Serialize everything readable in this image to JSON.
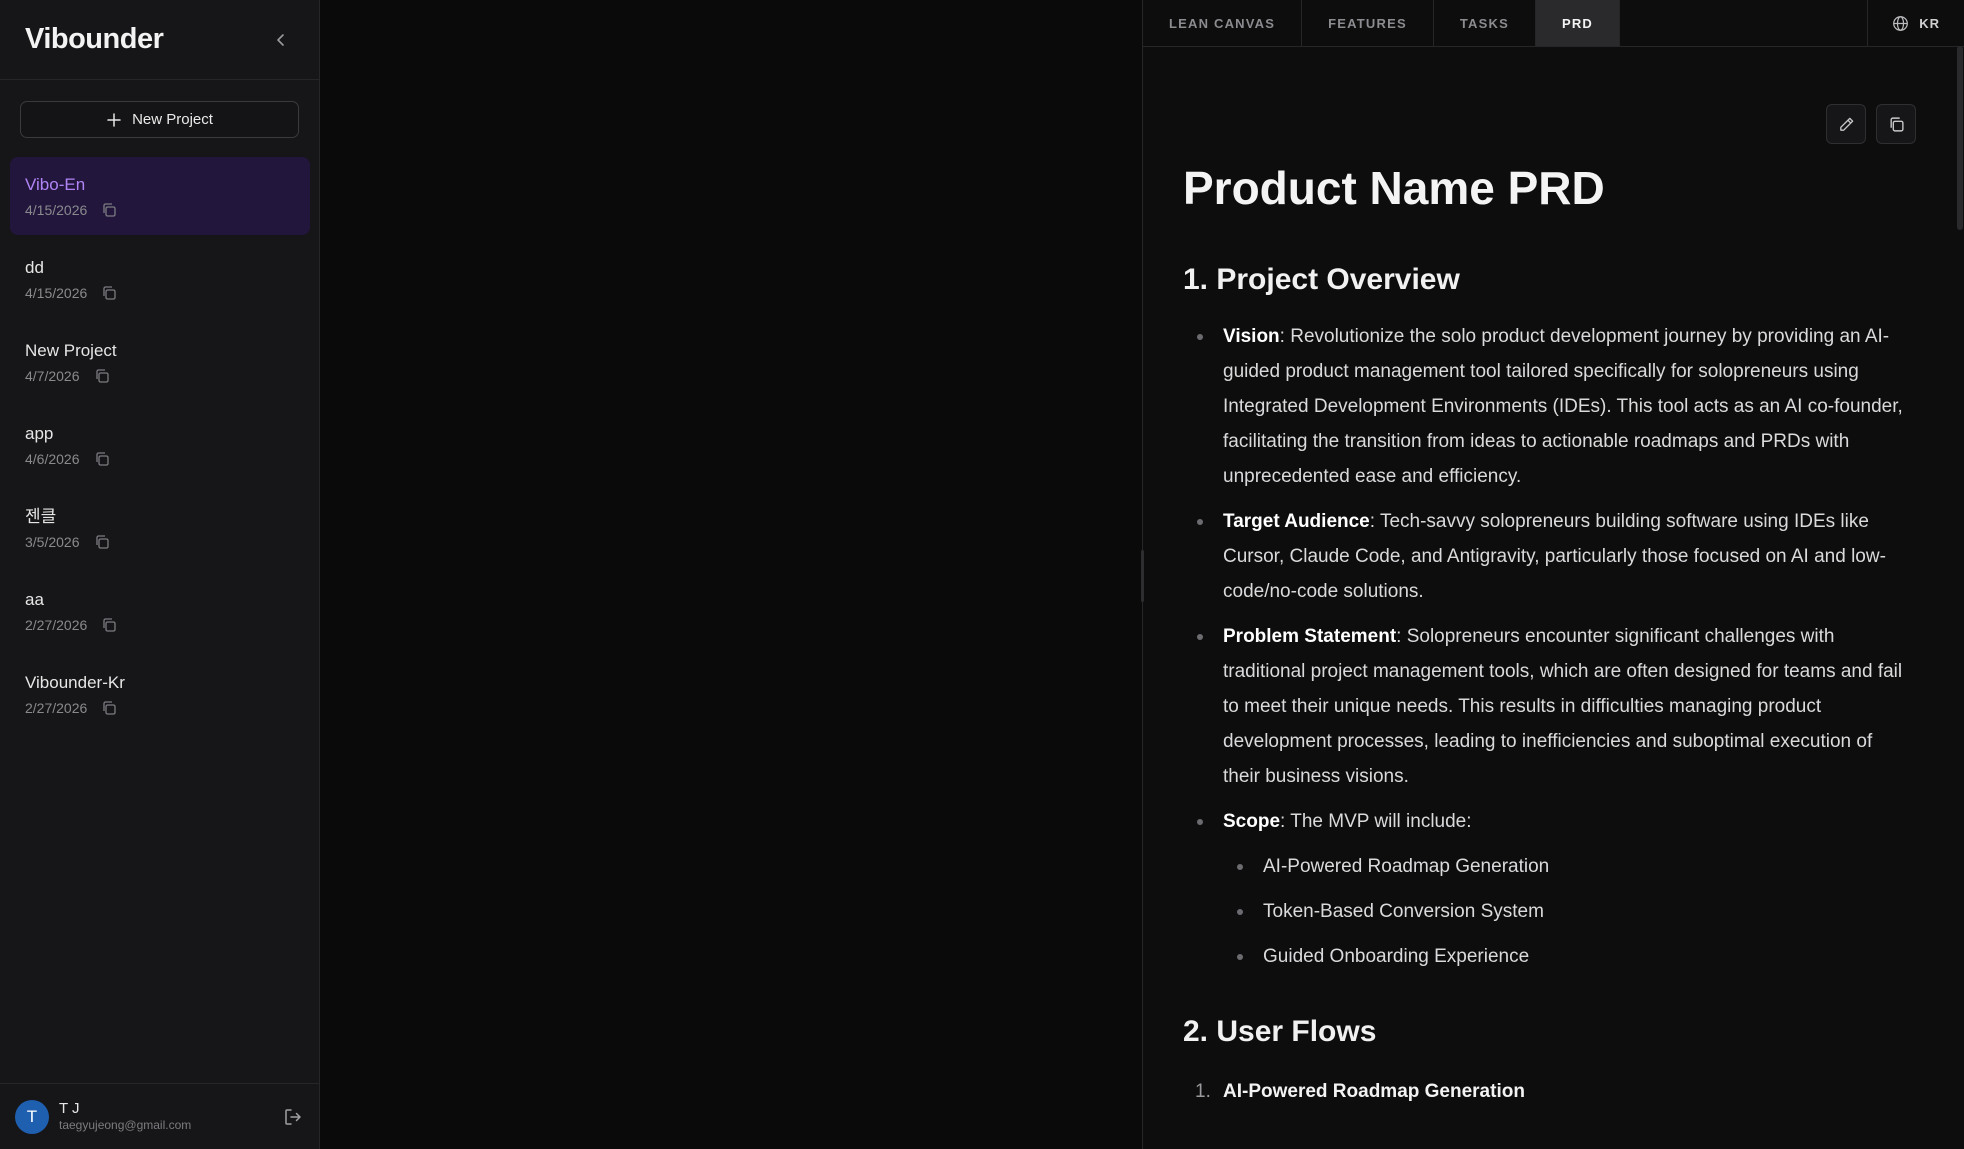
{
  "sidebar": {
    "app_title": "Vibounder",
    "new_project_label": "New Project",
    "projects": [
      {
        "name": "Vibo-En",
        "date": "4/15/2026",
        "active": true
      },
      {
        "name": "dd",
        "date": "4/15/2026"
      },
      {
        "name": "New Project",
        "date": "4/7/2026"
      },
      {
        "name": "app",
        "date": "4/6/2026"
      },
      {
        "name": "젠클",
        "date": "3/5/2026"
      },
      {
        "name": "aa",
        "date": "2/27/2026"
      },
      {
        "name": "Vibounder-Kr",
        "date": "2/27/2026"
      }
    ],
    "user": {
      "initial": "T",
      "name": "T J",
      "email": "taegyujeong@gmail.com"
    }
  },
  "tabs": [
    {
      "label": "LEAN CANVAS"
    },
    {
      "label": "FEATURES"
    },
    {
      "label": "TASKS"
    },
    {
      "label": "PRD",
      "active": true
    }
  ],
  "language": {
    "label": "KR"
  },
  "doc": {
    "title": "Product Name PRD",
    "section1": {
      "heading": "1. Project Overview",
      "items": [
        {
          "key": "Vision",
          "text": ": Revolutionize the solo product development journey by providing an AI-guided product management tool tailored specifically for solopreneurs using Integrated Development Environments (IDEs). This tool acts as an AI co-founder, facilitating the transition from ideas to actionable roadmaps and PRDs with unprecedented ease and efficiency."
        },
        {
          "key": "Target Audience",
          "text": ": Tech-savvy solopreneurs building software using IDEs like Cursor, Claude Code, and Antigravity, particularly those focused on AI and low-code/no-code solutions."
        },
        {
          "key": "Problem Statement",
          "text": ": Solopreneurs encounter significant challenges with traditional project management tools, which are often designed for teams and fail to meet their unique needs. This results in difficulties managing product development processes, leading to inefficiencies and suboptimal execution of their business visions."
        },
        {
          "key": "Scope",
          "text": ": The MVP will include:"
        }
      ],
      "scope_items": [
        "AI-Powered Roadmap Generation",
        "Token-Based Conversion System",
        "Guided Onboarding Experience"
      ]
    },
    "section2": {
      "heading": "2. User Flows",
      "first_item": {
        "num": "1.",
        "text": "AI-Powered Roadmap Generation"
      }
    }
  },
  "colors": {
    "accent": "#b084f5",
    "active_bg": "#22163d",
    "avatar": "#1f5fb0"
  }
}
